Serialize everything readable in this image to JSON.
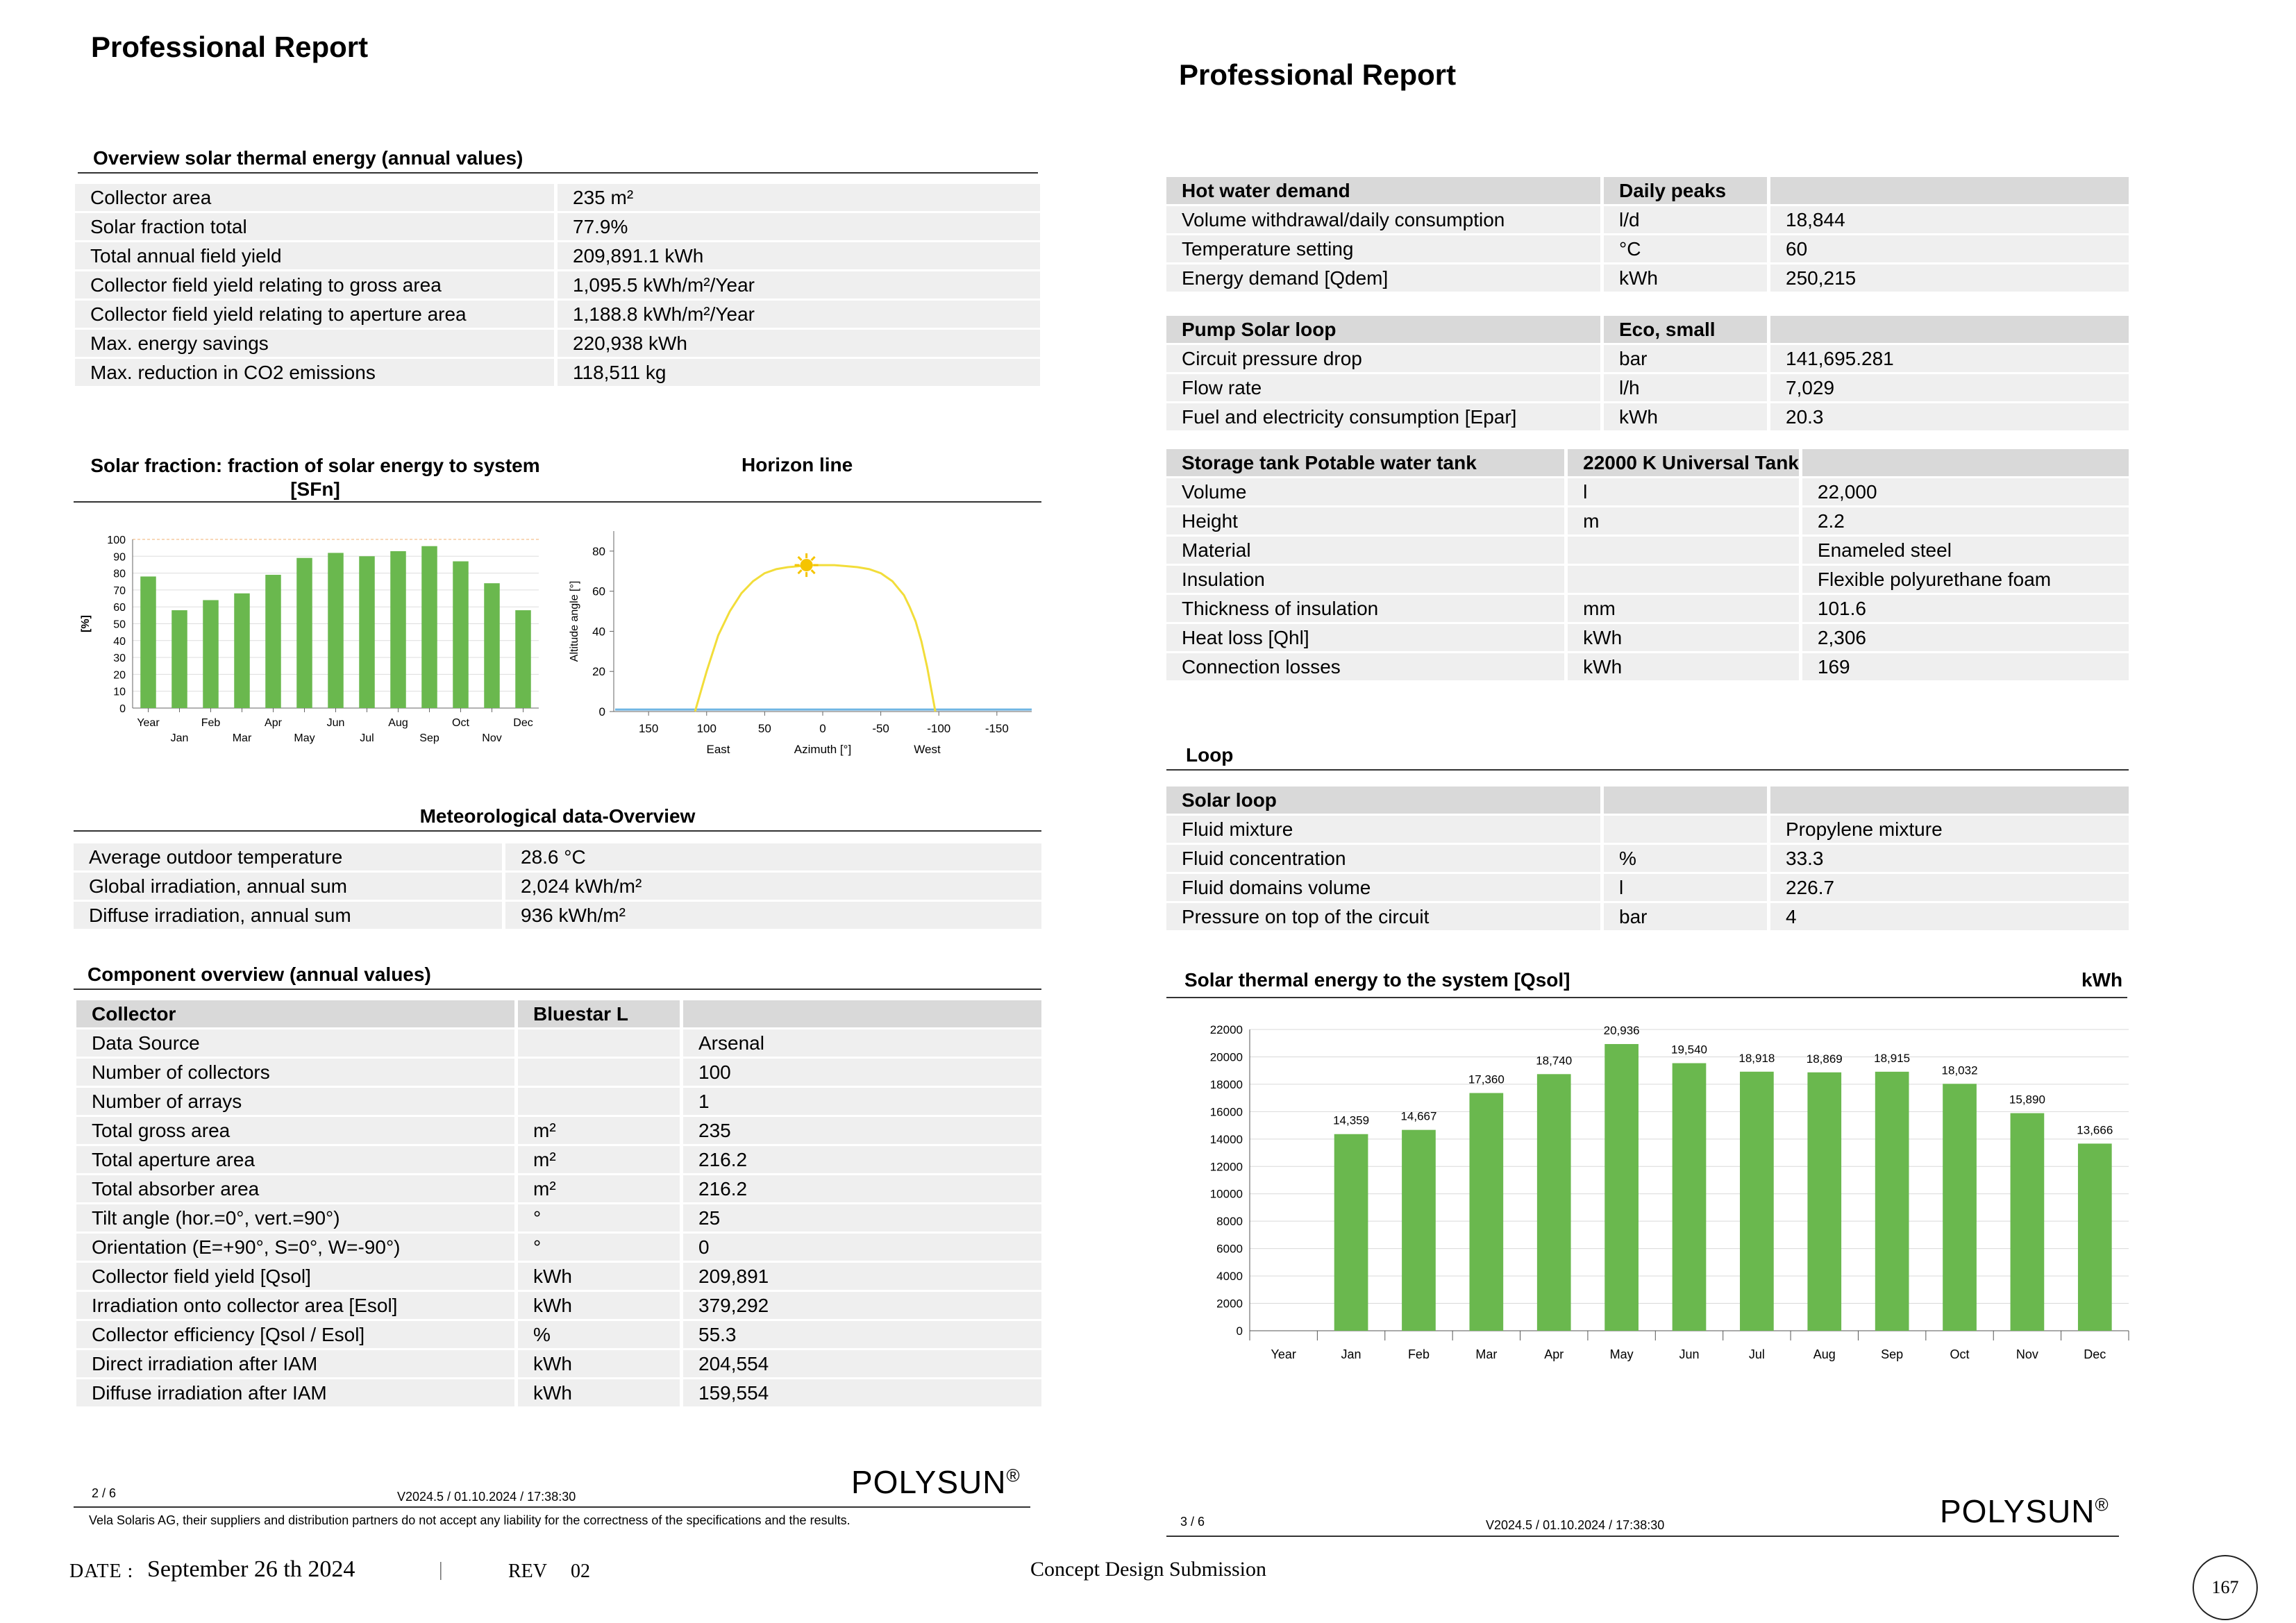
{
  "left": {
    "title": "Professional Report",
    "overview": {
      "title": "Overview solar thermal energy (annual values)",
      "rows": [
        [
          "Collector area",
          "235 m²"
        ],
        [
          "Solar fraction total",
          "77.9%"
        ],
        [
          "Total annual field yield",
          "209,891.1 kWh"
        ],
        [
          "Collector field yield relating to gross area",
          "1,095.5 kWh/m²/Year"
        ],
        [
          "Collector field yield relating to aperture area",
          "1,188.8 kWh/m²/Year"
        ],
        [
          "Max. energy savings",
          "220,938 kWh"
        ],
        [
          "Max. reduction in CO2 emissions",
          "118,511 kg"
        ]
      ]
    },
    "solar_fraction_title_1": "Solar fraction: fraction of solar energy to system",
    "solar_fraction_title_2": "[SFn]",
    "horizon_title": "Horizon line",
    "meteo": {
      "title": "Meteorological data-Overview",
      "rows": [
        [
          "Average outdoor temperature",
          "28.6 °C"
        ],
        [
          "Global irradiation, annual sum",
          "2,024 kWh/m²"
        ],
        [
          "Diffuse irradiation, annual sum",
          "936 kWh/m²"
        ]
      ]
    },
    "component": {
      "title": "Component overview (annual values)",
      "header": [
        "Collector",
        "Bluestar L",
        ""
      ],
      "rows": [
        [
          "Data Source",
          "",
          "Arsenal"
        ],
        [
          "Number of collectors",
          "",
          "100"
        ],
        [
          "Number of arrays",
          "",
          "1"
        ],
        [
          "Total gross area",
          "m²",
          "235"
        ],
        [
          "Total aperture area",
          "m²",
          "216.2"
        ],
        [
          "Total absorber area",
          "m²",
          "216.2"
        ],
        [
          "Tilt angle (hor.=0°, vert.=90°)",
          "°",
          "25"
        ],
        [
          "Orientation (E=+90°, S=0°, W=-90°)",
          "°",
          "0"
        ],
        [
          "Collector field yield [Qsol]",
          "kWh",
          "209,891"
        ],
        [
          "Irradiation onto collector area [Esol]",
          "kWh",
          "379,292"
        ],
        [
          "Collector efficiency [Qsol / Esol]",
          "%",
          "55.3"
        ],
        [
          "Direct irradiation after IAM",
          "kWh",
          "204,554"
        ],
        [
          "Diffuse irradiation after IAM",
          "kWh",
          "159,554"
        ]
      ]
    },
    "footer": {
      "page": "2  /  6",
      "version": "V2024.5 / 01.10.2024 / 17:38:30",
      "brand": "POLYSUN",
      "reg": "®",
      "disclaimer": "Vela Solaris AG, their suppliers and distribution partners do not accept any liability for the correctness of the specifications and the results."
    }
  },
  "right": {
    "title": "Professional Report",
    "tables": [
      {
        "header": [
          "Hot water demand",
          "Daily peaks",
          ""
        ],
        "rows": [
          [
            "Volume withdrawal/daily consumption",
            "l/d",
            "18,844"
          ],
          [
            "Temperature setting",
            "°C",
            "60"
          ],
          [
            "Energy demand [Qdem]",
            "kWh",
            "250,215"
          ]
        ]
      },
      {
        "header": [
          "Pump Solar loop",
          "Eco, small",
          ""
        ],
        "rows": [
          [
            "Circuit pressure drop",
            "bar",
            "141,695.281"
          ],
          [
            "Flow rate",
            "l/h",
            "7,029"
          ],
          [
            "Fuel and electricity consumption [Epar]",
            "kWh",
            "20.3"
          ]
        ]
      },
      {
        "header": [
          "Storage tank Potable water tank",
          "22000 K Universal Tank",
          ""
        ],
        "rows": [
          [
            "Volume",
            "l",
            "22,000"
          ],
          [
            "Height",
            "m",
            "2.2"
          ],
          [
            "Material",
            "",
            "Enameled steel"
          ],
          [
            "Insulation",
            "",
            "Flexible polyurethane foam"
          ],
          [
            "Thickness of insulation",
            "mm",
            "101.6"
          ],
          [
            "Heat loss [Qhl]",
            "kWh",
            "2,306"
          ],
          [
            "Connection losses",
            "kWh",
            "169"
          ]
        ]
      }
    ],
    "loop": {
      "title": "Loop",
      "header": [
        "Solar loop",
        "",
        ""
      ],
      "rows": [
        [
          "Fluid mixture",
          "",
          "Propylene mixture"
        ],
        [
          "Fluid concentration",
          "%",
          "33.3"
        ],
        [
          "Fluid domains volume",
          "l",
          "226.7"
        ],
        [
          "Pressure on top of the circuit",
          "bar",
          "4"
        ]
      ]
    },
    "qsol_title": "Solar thermal energy to the system [Qsol]",
    "qsol_unit": "kWh",
    "footer": {
      "page": "3  /  6",
      "version": "V2024.5 / 01.10.2024 / 17:38:30",
      "brand": "POLYSUN",
      "reg": "®"
    }
  },
  "bottom": {
    "date_label": "DATE :",
    "date_value": "September 26 th 2024",
    "separator": "|",
    "rev_label": "REV",
    "rev_value": "02",
    "submission": "Concept Design Submission",
    "page_number": "167"
  },
  "chart_data": [
    {
      "type": "bar",
      "title": "Solar fraction: fraction of solar energy to system [SFn]",
      "ylabel": "[%]",
      "categories": [
        "Year",
        "Jan",
        "Feb",
        "Mar",
        "Apr",
        "May",
        "Jun",
        "Jul",
        "Aug",
        "Sep",
        "Oct",
        "Nov",
        "Dec"
      ],
      "values": [
        78,
        58,
        64,
        68,
        79,
        89,
        92,
        90,
        93,
        96,
        87,
        74,
        58
      ],
      "ylim": [
        0,
        100
      ],
      "yticks": [
        0,
        10,
        20,
        30,
        40,
        50,
        60,
        70,
        80,
        90,
        100
      ],
      "color": "#6ab84e"
    },
    {
      "type": "line",
      "title": "Horizon line",
      "xlabel": "Azimuth [°]",
      "ylabel": "Altitude angle [°]",
      "xlim": [
        180,
        -180
      ],
      "ylim": [
        0,
        90
      ],
      "xticks": [
        150,
        100,
        50,
        0,
        -50,
        -100,
        -150
      ],
      "yticks": [
        0,
        20,
        40,
        60,
        80
      ],
      "x_annotations": [
        "East",
        "West"
      ],
      "sun_path": {
        "x": [
          110,
          100,
          90,
          80,
          70,
          60,
          50,
          40,
          30,
          20,
          10,
          0,
          -10,
          -20,
          -30,
          -40,
          -50,
          -60,
          -70,
          -75,
          -80,
          -85,
          -90,
          -97
        ],
        "y": [
          0,
          20,
          38,
          50,
          59,
          65,
          69,
          71,
          72,
          72.5,
          73,
          73,
          73,
          72.5,
          72,
          71,
          69,
          65,
          58,
          52,
          45,
          35,
          22,
          0
        ]
      },
      "sun_marker": {
        "x": 14,
        "y": 73
      },
      "horizon": {
        "y": 1
      },
      "colors": {
        "sun_path": "#f2dd3a",
        "horizon": "#6fb5e3"
      }
    },
    {
      "type": "bar",
      "title": "Solar thermal energy to the system [Qsol]",
      "unit": "kWh",
      "categories": [
        "Year",
        "Jan",
        "Feb",
        "Mar",
        "Apr",
        "May",
        "Jun",
        "Jul",
        "Aug",
        "Sep",
        "Oct",
        "Nov",
        "Dec"
      ],
      "values": [
        null,
        14359,
        14667,
        17360,
        18740,
        20936,
        19540,
        18918,
        18869,
        18915,
        18032,
        15890,
        13666
      ],
      "labels": [
        "",
        "14,359",
        "14,667",
        "17,360",
        "18,740",
        "20,936",
        "19,540",
        "18,918",
        "18,869",
        "18,915",
        "18,032",
        "15,890",
        "13,666"
      ],
      "ylim": [
        0,
        22000
      ],
      "yticks": [
        0,
        2000,
        4000,
        6000,
        8000,
        10000,
        12000,
        14000,
        16000,
        18000,
        20000,
        22000
      ],
      "color": "#6ab84e"
    }
  ]
}
